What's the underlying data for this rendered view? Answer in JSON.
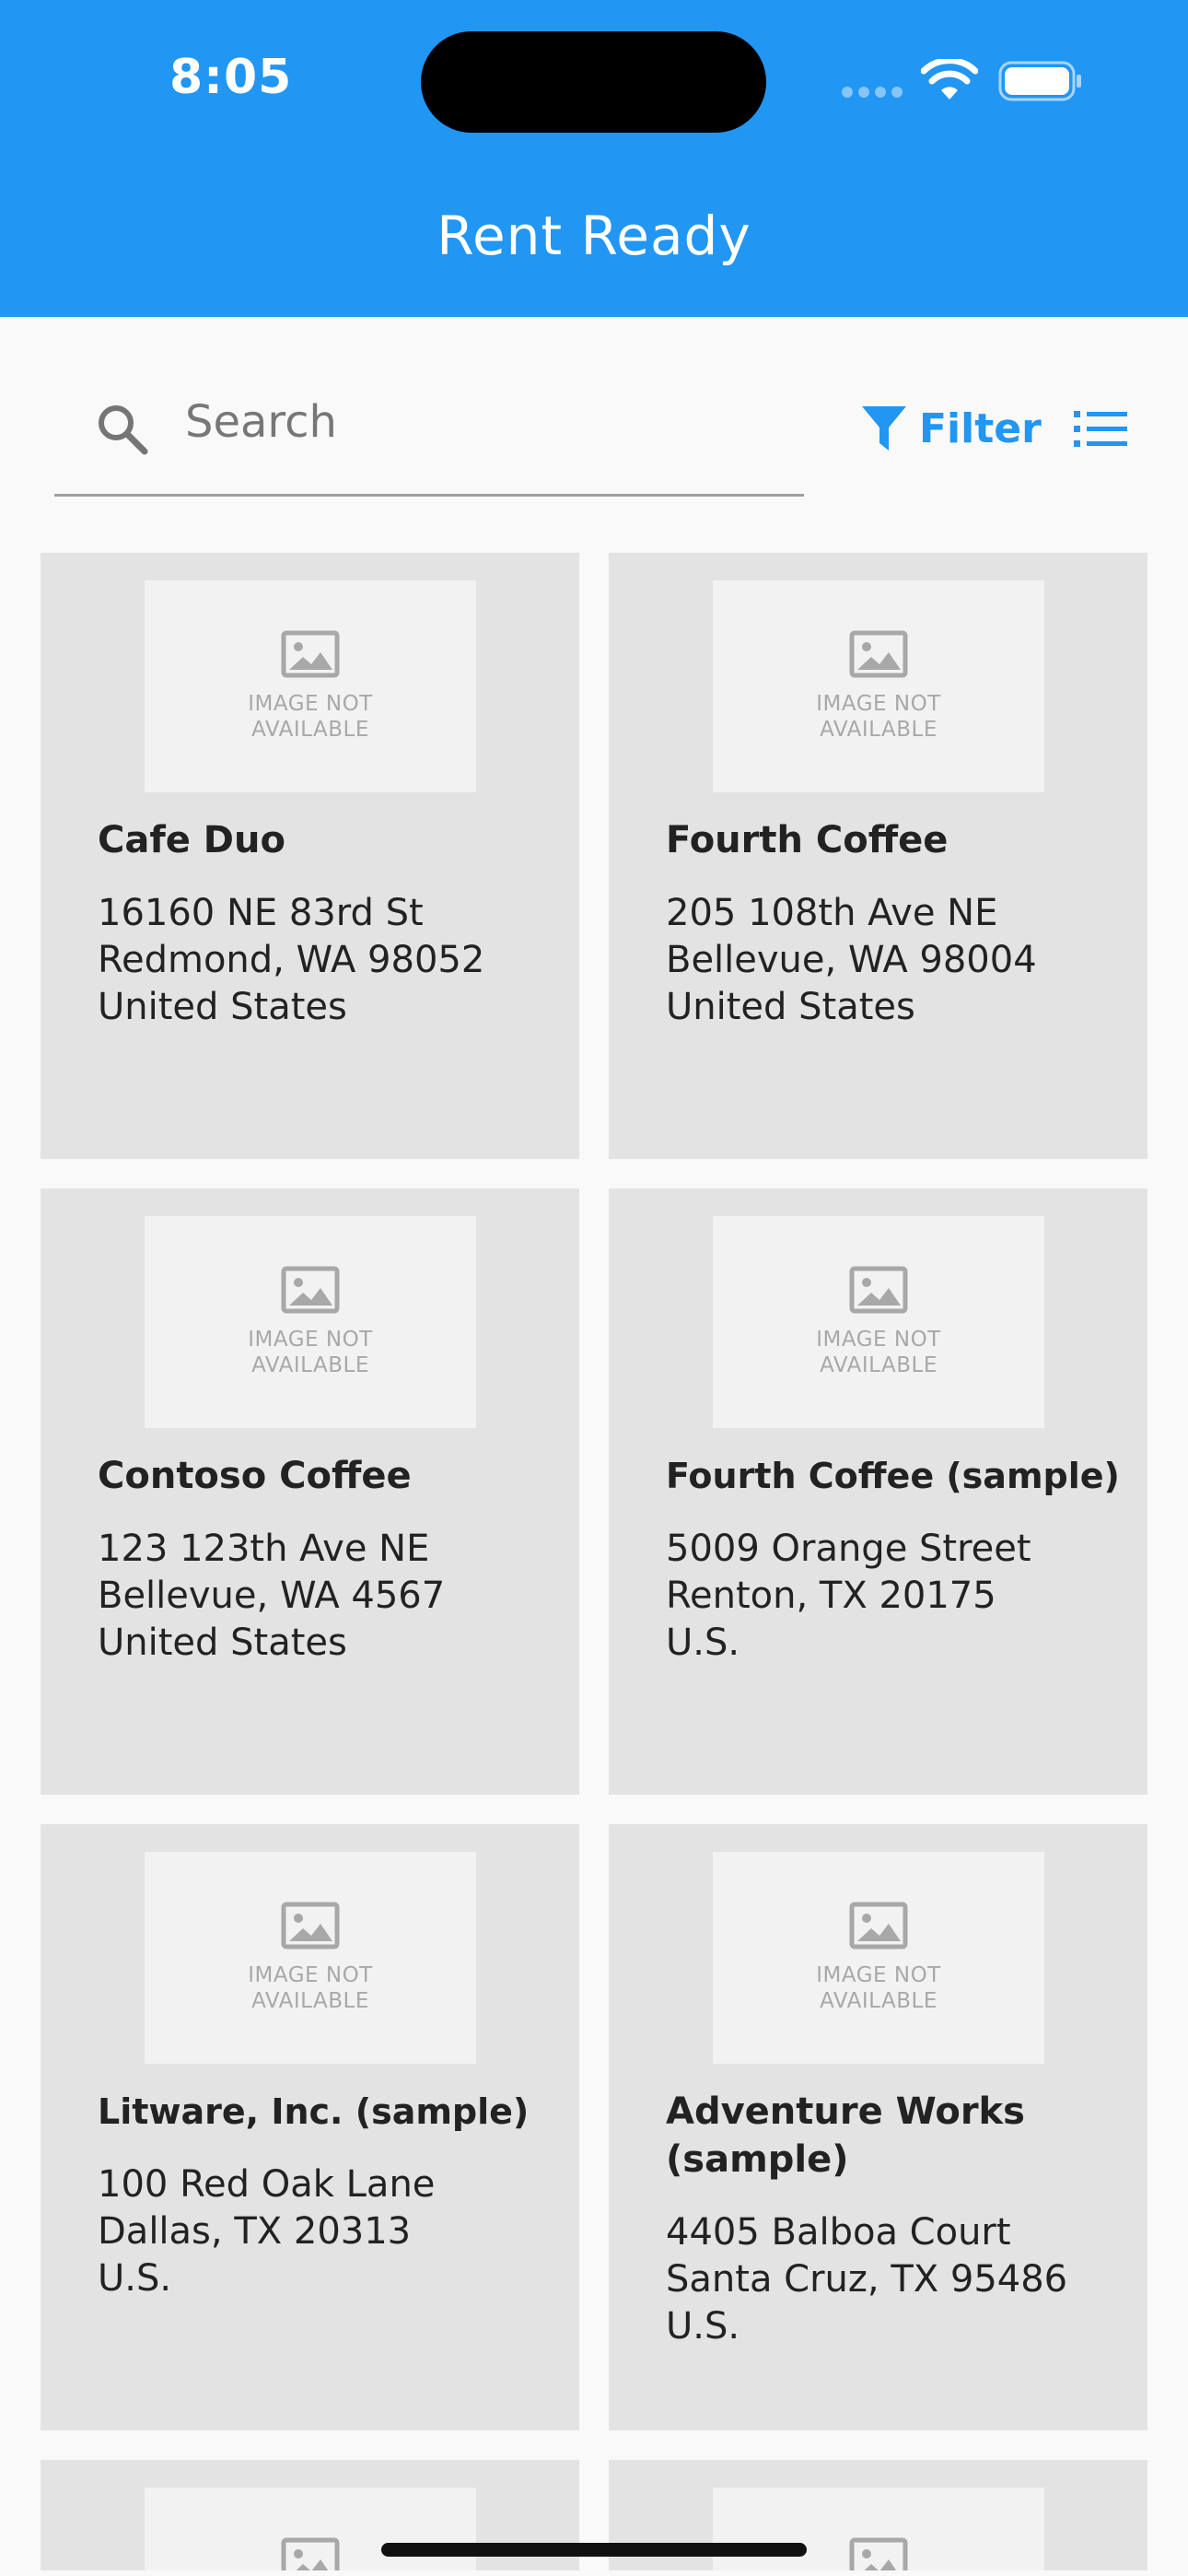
{
  "status_bar": {
    "time": "8:05"
  },
  "header": {
    "title": "Rent Ready",
    "background_color": "#2196f3"
  },
  "toolbar": {
    "search_placeholder": "Search",
    "search_value": "",
    "filter_label": "Filter",
    "accent_color": "#2196f3"
  },
  "placeholder_image": {
    "line1": "IMAGE NOT",
    "line2": "AVAILABLE"
  },
  "accounts": [
    {
      "name": "Cafe Duo",
      "address": [
        "16160 NE 83rd St",
        "Redmond, WA 98052",
        "United States"
      ]
    },
    {
      "name": "Fourth Coffee",
      "address": [
        "205 108th Ave NE",
        "Bellevue, WA 98004",
        "United States"
      ]
    },
    {
      "name": "Contoso Coffee",
      "address": [
        "123 123th Ave NE",
        "Bellevue, WA 4567",
        "United States"
      ]
    },
    {
      "name": "Fourth Coffee (sample)",
      "address": [
        "5009 Orange Street",
        "Renton, TX 20175",
        "U.S."
      ]
    },
    {
      "name": "Litware, Inc. (sample)",
      "address": [
        "100 Red Oak Lane",
        "Dallas, TX 20313",
        "U.S."
      ]
    },
    {
      "name": "Adventure Works (sample)",
      "name_lines": [
        "Adventure Works",
        "(sample)"
      ],
      "address": [
        "4405 Balboa Court",
        "Santa Cruz, TX 95486",
        "U.S."
      ]
    }
  ]
}
